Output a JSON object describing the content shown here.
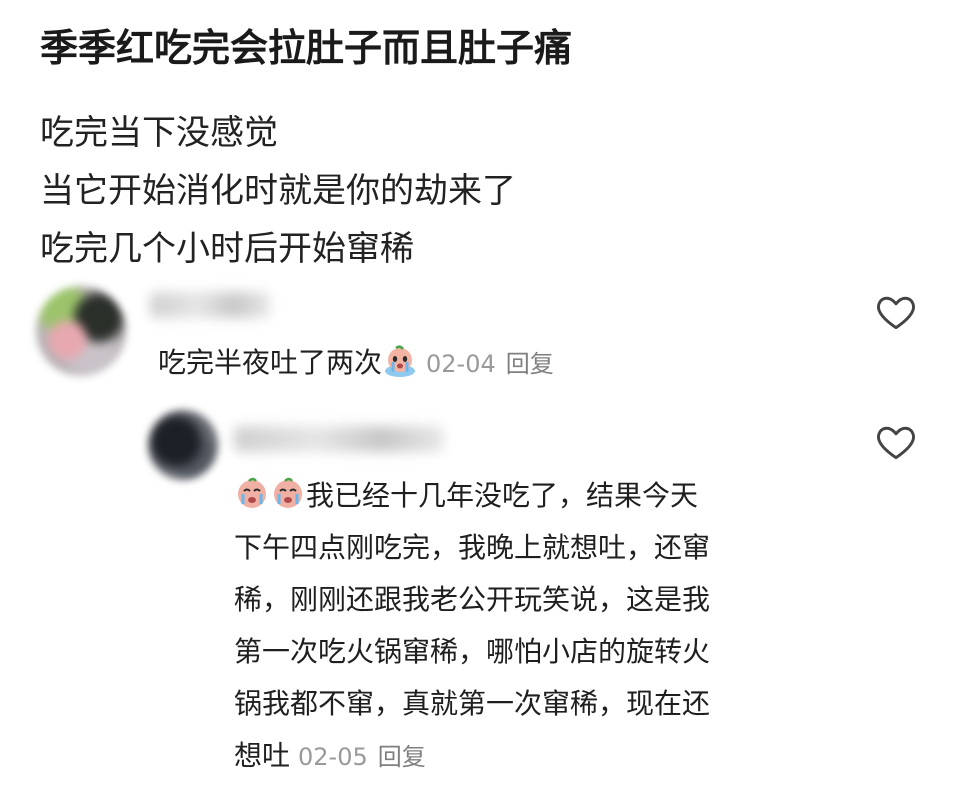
{
  "post": {
    "title": "季季红吃完会拉肚子而且肚子痛",
    "lines": [
      "吃完当下没感觉",
      "当它开始消化时就是你的劫来了",
      "吃完几个小时后开始窜稀"
    ]
  },
  "comments": [
    {
      "text": "吃完半夜吐了两次",
      "emoji": [
        "crying-face-icon"
      ],
      "date": "02-04",
      "reply_label": "回复"
    },
    {
      "emoji": [
        "crying-face-icon",
        "crying-face-icon"
      ],
      "lines": [
        "我已经十几年没吃了，结果今天",
        "下午四点刚吃完，我晚上就想吐，还窜",
        "稀，刚刚还跟我老公开玩笑说，这是我",
        "第一次吃火锅窜稀，哪怕小店的旋转火",
        "锅我都不窜，真就第一次窜稀，现在还",
        "想吐"
      ],
      "date": "02-05",
      "reply_label": "回复"
    }
  ],
  "colors": {
    "text": "#1f1f1f",
    "meta": "#9a9a9a",
    "heart_outline": "#444444"
  }
}
